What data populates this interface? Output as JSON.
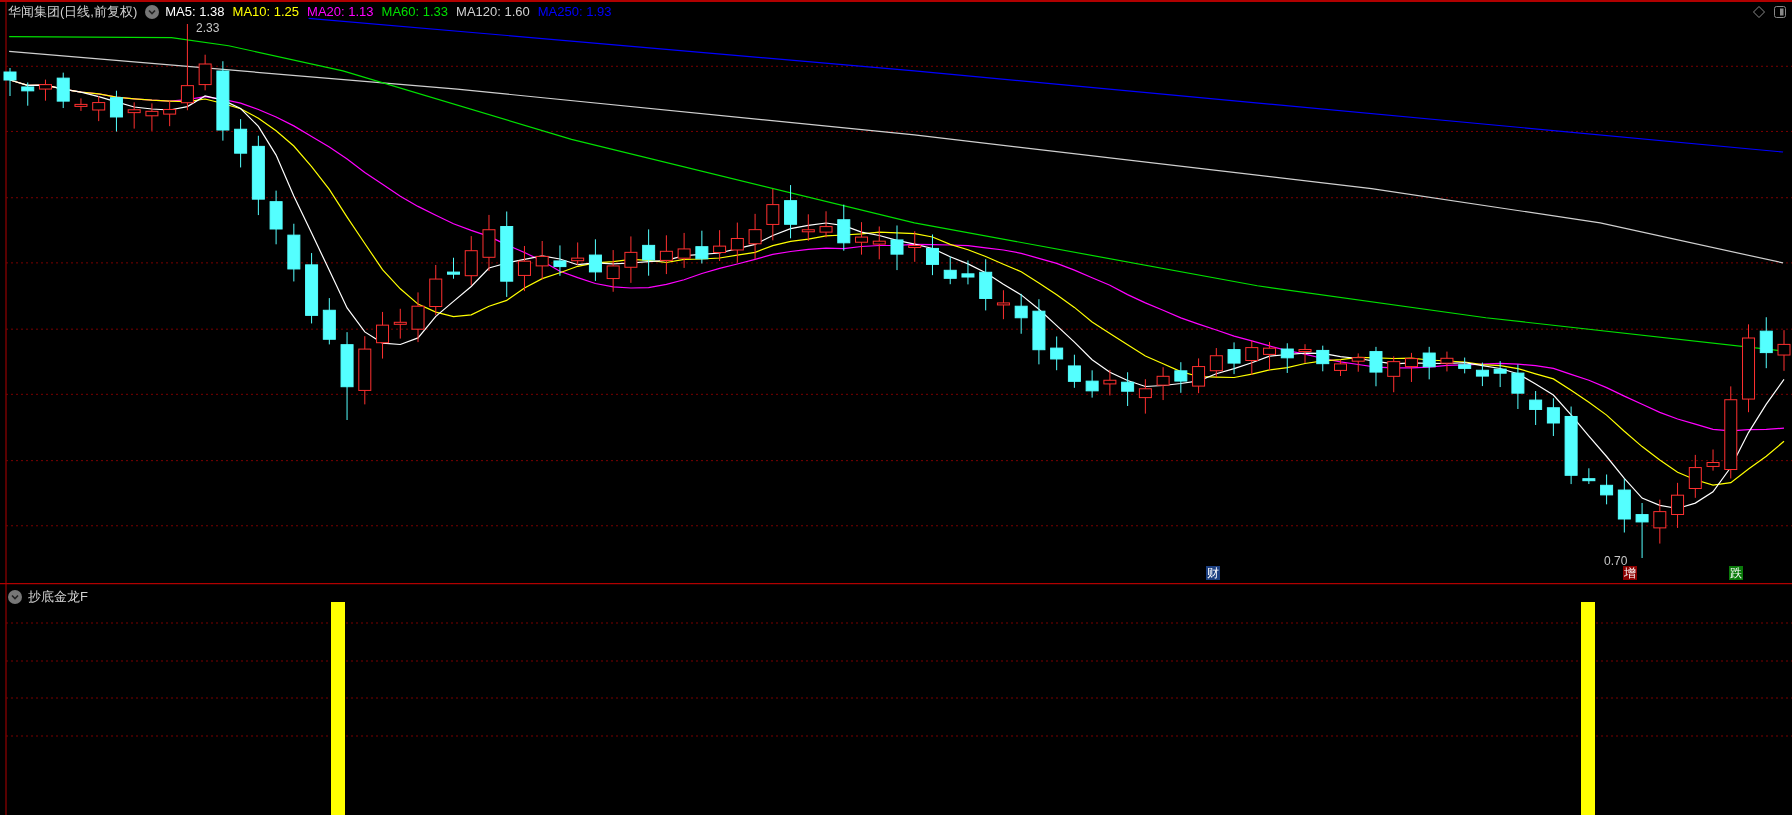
{
  "header": {
    "title": "华闻集团(日线,前复权)",
    "indicators": [
      {
        "label": "MA5: 1.38",
        "color": "#ffffff"
      },
      {
        "label": "MA10: 1.25",
        "color": "#ffff00"
      },
      {
        "label": "MA20: 1.13",
        "color": "#ff00ff"
      },
      {
        "label": "MA60: 1.33",
        "color": "#00e000"
      },
      {
        "label": "MA120: 1.60",
        "color": "#d0d0d0"
      },
      {
        "label": "MA250: 1.93",
        "color": "#0000ff"
      }
    ]
  },
  "main_chart": {
    "high_label": "2.33",
    "low_label": "0.70",
    "event_markers": [
      {
        "text": "财",
        "color": "#1c3f80"
      },
      {
        "text": "增",
        "color": "#8b0000"
      },
      {
        "text": "跌",
        "color": "#0a7a0a"
      }
    ]
  },
  "sub_panel": {
    "title": "抄底金龙F"
  }
}
